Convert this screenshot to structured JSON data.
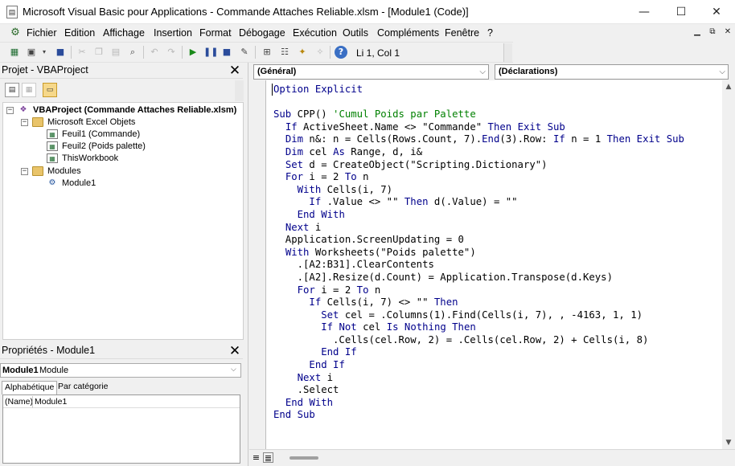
{
  "window": {
    "title": "Microsoft Visual Basic pour Applications - Commande Attaches Reliable.xlsm - [Module1 (Code)]",
    "controls": [
      "—",
      "☐",
      "✕"
    ]
  },
  "menu": {
    "items": [
      "Fichier",
      "Edition",
      "Affichage",
      "Insertion",
      "Format",
      "Débogage",
      "Exécution",
      "Outils",
      "Compléments",
      "Fenêtre",
      "?"
    ]
  },
  "toolbar": {
    "cursor_position": "Li 1, Col 1"
  },
  "project": {
    "title": "Projet - VBAProject",
    "close": "✕",
    "tree": {
      "root": "VBAProject (Commande Attaches Reliable.xlsm)",
      "excel_objects_folder": "Microsoft Excel Objets",
      "sheets": [
        "Feuil1 (Commande)",
        "Feuil2 (Poids palette)",
        "ThisWorkbook"
      ],
      "modules_folder": "Modules",
      "modules": [
        "Module1"
      ]
    }
  },
  "properties": {
    "title": "Propriétés - Module1",
    "close": "✕",
    "object_name": "Module1",
    "object_type": "Module",
    "tabs": [
      "Alphabétique",
      "Par catégorie"
    ],
    "rows": [
      {
        "name": "(Name)",
        "value": "Module1"
      }
    ]
  },
  "editor": {
    "object_dropdown": "(Général)",
    "procedure_dropdown": "(Déclarations)",
    "code_lines": [
      "Option Explicit",
      "",
      "Sub CPP() 'Cumul Poids par Palette",
      "  If ActiveSheet.Name <> \"Commande\" Then Exit Sub",
      "  Dim n&: n = Cells(Rows.Count, 7).End(3).Row: If n = 1 Then Exit Sub",
      "  Dim cel As Range, d, i&",
      "  Set d = CreateObject(\"Scripting.Dictionary\")",
      "  For i = 2 To n",
      "    With Cells(i, 7)",
      "      If .Value <> \"\" Then d(.Value) = \"\"",
      "    End With",
      "  Next i",
      "  Application.ScreenUpdating = 0",
      "  With Worksheets(\"Poids palette\")",
      "    .[A2:B31].ClearContents",
      "    .[A2].Resize(d.Count) = Application.Transpose(d.Keys)",
      "    For i = 2 To n",
      "      If Cells(i, 7) <> \"\" Then",
      "        Set cel = .Columns(1).Find(Cells(i, 7), , -4163, 1, 1)",
      "        If Not cel Is Nothing Then",
      "          .Cells(cel.Row, 2) = .Cells(cel.Row, 2) + Cells(i, 8)",
      "        End If",
      "      End If",
      "    Next i",
      "    .Select",
      "  End With",
      "End Sub"
    ],
    "keywords": [
      "Option Explicit",
      "Sub",
      "If",
      "Then",
      "Exit",
      "Dim",
      "As",
      "Set",
      "For",
      "To",
      "With",
      "End",
      "Next",
      "Not",
      "Is",
      "Nothing"
    ]
  },
  "colors": {
    "keyword": "#00008b",
    "comment": "#008000",
    "text": "#000000"
  }
}
